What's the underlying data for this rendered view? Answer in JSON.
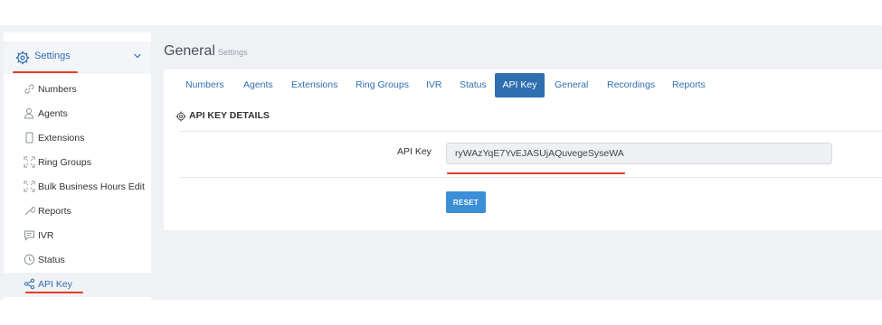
{
  "sidebar": {
    "section_label": "Settings",
    "items": [
      {
        "label": "Numbers",
        "icon": "link-icon"
      },
      {
        "label": "Agents",
        "icon": "users-icon"
      },
      {
        "label": "Extensions",
        "icon": "phone-icon"
      },
      {
        "label": "Ring Groups",
        "icon": "expand-icon"
      },
      {
        "label": "Bulk Business Hours Edit",
        "icon": "expand-icon"
      },
      {
        "label": "Reports",
        "icon": "wrench-icon"
      },
      {
        "label": "IVR",
        "icon": "message-icon"
      },
      {
        "label": "Status",
        "icon": "clock-icon"
      },
      {
        "label": "API Key",
        "icon": "share-icon"
      }
    ]
  },
  "header": {
    "title": "General",
    "subtitle": "Settings"
  },
  "tabs": [
    "Numbers",
    "Agents",
    "Extensions",
    "Ring Groups",
    "IVR",
    "Status",
    "API Key",
    "General",
    "Recordings",
    "Reports"
  ],
  "active_tab": "API Key",
  "section": {
    "title": "API KEY DETAILS"
  },
  "form": {
    "api_key_label": "API Key",
    "api_key_value": "ryWAzYqE7YvEJASUjAQuvegeSyseWA",
    "reset_label": "RESET"
  },
  "colors": {
    "accent": "#2f6fb0",
    "button": "#3b8fd6",
    "highlight_underline": "#e23b2a",
    "background": "#eff1f5"
  }
}
